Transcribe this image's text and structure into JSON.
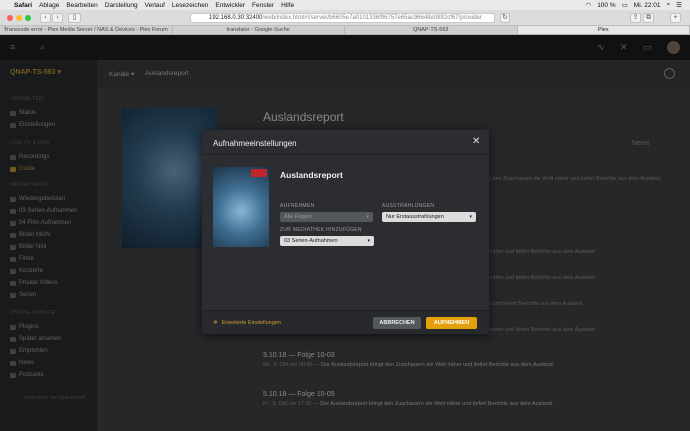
{
  "menubar": {
    "items": [
      "Safari",
      "Ablage",
      "Bearbeiten",
      "Darstellung",
      "Verlauf",
      "Lesezeichen",
      "Entwickler",
      "Fenster",
      "Hilfe"
    ],
    "battery": "100 %",
    "clock": "Mi. 22:01"
  },
  "safari": {
    "url_host": "192.168.0.30:32400",
    "url_path": "/web/index.html#!/server/b6605e7a0101336f96757e65ac96648e0892cf67/provider",
    "tabs": [
      "Transcode error - Plex Media Server / NAS & Devices - Plex Forum",
      "translator - Google-Suche",
      "QNAP-TS-563",
      "Plex"
    ],
    "active_tab": 3
  },
  "sidebar": {
    "server": "QNAP-TS-563",
    "sections": [
      {
        "title": "VERWALTEN",
        "items": [
          "Status",
          "Einstellungen"
        ]
      },
      {
        "title": "LIVE-TV & DVR",
        "items": [
          "Recordings",
          "Guide"
        ]
      },
      {
        "title": "MEDIATHEKEN",
        "items": [
          "Wiedergabelisten",
          "03 Serien-Aufnahmen",
          "04 Film-Aufnahmen",
          "Bilder Michi",
          "Bilder Nini",
          "Filme",
          "Konzerte",
          "Private Videos",
          "Serien"
        ]
      },
      {
        "title": "ONLINE-INHALTE",
        "items": [
          "Plugins",
          "Später ansehen",
          "Empfohlen",
          "News",
          "Podcasts"
        ]
      }
    ],
    "credit": "Unterstützt von Gracenote®"
  },
  "header": {
    "crumb_channels": "Kanäle",
    "crumb_show": "Auslandsreport"
  },
  "main": {
    "title": "Auslandsreport",
    "badge": "News",
    "episodes": [
      {
        "title": "",
        "date": "",
        "desc": "bringt den Zuschauern die Welt näher und liefert Berichte aus dem Ausland."
      },
      {
        "title": "",
        "date": "",
        "desc": "Welt näher und liefert Berichte aus dem Ausland."
      },
      {
        "title": "",
        "date": "",
        "desc": "Welt näher und liefert Berichte aus dem Ausland."
      },
      {
        "title": "",
        "date": "",
        "desc": "näher und liefert Berichte aus dem Ausland."
      },
      {
        "title": "",
        "date": "",
        "desc": "Welt näher und liefert Berichte aus dem Ausland."
      },
      {
        "title": "3.10.18 — Folge 10-03",
        "date": "Mi., 3. Okt um 00:45",
        "desc": "Der Auslandsreport bringt den Zuschauern die Welt näher und liefert Berichte aus dem Ausland."
      },
      {
        "title": "5.10.18 — Folge 10-05",
        "date": "Fr., 5. Okt um 17:30",
        "desc": "Der Auslandsreport bringt den Zuschauern die Welt näher und liefert Berichte aus dem Ausland."
      }
    ]
  },
  "modal": {
    "title": "Aufnahmeeinstellungen",
    "show": "Auslandsreport",
    "record_label": "AUFNEHMEN",
    "record_value": "Alle Folgen",
    "airings_label": "AUSSTRAHLUNGEN",
    "airings_value": "Nur Erstausstrahlungen",
    "library_label": "ZUR MEDIATHEK HINZUFÜGEN",
    "library_value": "03 Serien-Aufnahmen",
    "advanced": "Erweiterte Einstellungen",
    "cancel": "ABBRECHEN",
    "save": "AUFNEHMEN"
  },
  "colors": {
    "accent": "#e5a00d",
    "sidebar_accent": "#cc9e38",
    "rec_badge": "#c0262b"
  }
}
